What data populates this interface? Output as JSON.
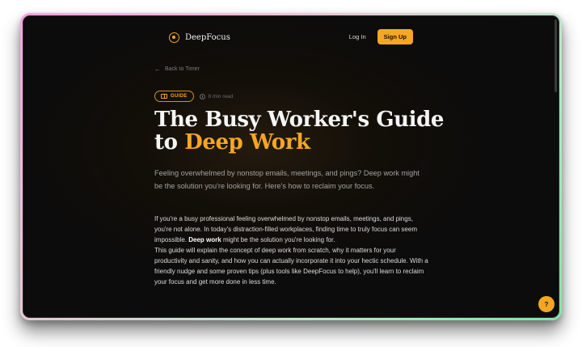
{
  "brand": {
    "name": "DeepFocus",
    "logo_icon": "target-icon",
    "accent": "#f5a623"
  },
  "nav": {
    "login_label": "Log In",
    "signup_label": "Sign Up"
  },
  "back_link": {
    "label": "Back to Timer",
    "icon": "arrow-left-icon"
  },
  "meta": {
    "badge": "GUIDE",
    "badge_icon": "book-icon",
    "read_time": "8 min read",
    "time_icon": "clock-icon"
  },
  "article": {
    "title_part1": "The Busy Worker's Guide",
    "title_part2": "to ",
    "title_accent": "Deep Work",
    "subtitle": "Feeling overwhelmed by nonstop emails, meetings, and pings? Deep work might be the solution you're looking for. Here's how to reclaim your focus.",
    "para1_before": "If you're a busy professional feeling overwhelmed by nonstop emails, meetings, and pings, you're not alone. In today's distraction-filled workplaces, finding time to truly focus can seem impossible. ",
    "para1_bold": "Deep work",
    "para1_after": " might be the solution you're looking for.",
    "para2": "This guide will explain the concept of deep work from scratch, why it matters for your productivity and sanity, and how you can actually incorporate it into your hectic schedule. With a friendly nudge and some proven tips (plus tools like DeepFocus to help), you'll learn to reclaim your focus and get more done in less time."
  },
  "help_button": {
    "label": "?"
  }
}
